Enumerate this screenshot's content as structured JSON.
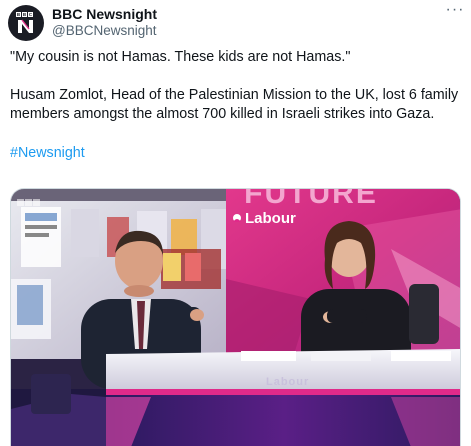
{
  "author": {
    "name": "BBC Newsnight",
    "handle": "@BBCNewsnight",
    "avatar_logo_text": "BBC N"
  },
  "actions": {
    "more_label": "···"
  },
  "tweet": {
    "quote": "\"My cousin is not Hamas. These kids are not Hamas.\"",
    "body": "Husam Zomlot, Head of the Palestinian Mission to the UK, lost 6 family members amongst the almost 700 killed in Israeli strikes into Gaza.",
    "hashtag": "#Newsnight"
  },
  "media": {
    "type": "video-still",
    "studio_banner_text": "FUTURE",
    "party_logo_text": "Labour",
    "desk_text": "Labour",
    "corner_logo_text": "BBC"
  },
  "colors": {
    "hashtag": "#1d9bf0",
    "handle": "#536471",
    "studio_magenta": "#d6247c",
    "studio_purple": "#3b1d7a",
    "desk_pink": "#e02a8a"
  }
}
